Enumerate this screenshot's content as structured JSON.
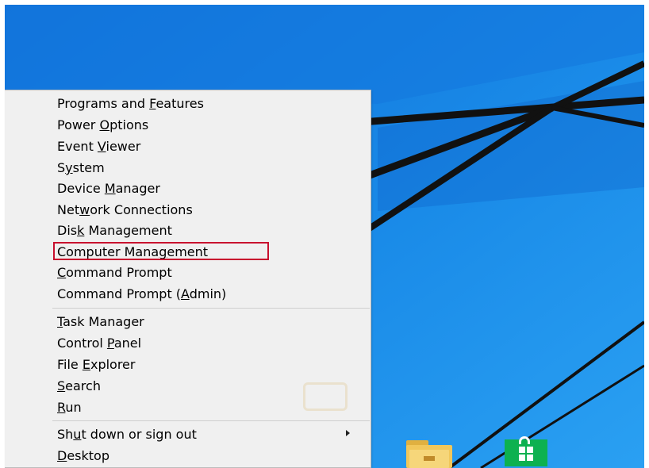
{
  "menu": {
    "group1": [
      {
        "pre": "Programs and ",
        "key": "F",
        "post": "eatures"
      },
      {
        "pre": "Power ",
        "key": "O",
        "post": "ptions"
      },
      {
        "pre": "Event ",
        "key": "V",
        "post": "iewer"
      },
      {
        "pre": "S",
        "key": "y",
        "post": "stem"
      },
      {
        "pre": "Device ",
        "key": "M",
        "post": "anager"
      },
      {
        "pre": "Net",
        "key": "w",
        "post": "ork Connections"
      },
      {
        "pre": "Dis",
        "key": "k",
        "post": " Management"
      },
      {
        "pre": "Computer Mana",
        "key": "g",
        "post": "ement"
      },
      {
        "pre": "",
        "key": "C",
        "post": "ommand Prompt"
      },
      {
        "pre": "Command Prompt (",
        "key": "A",
        "post": "dmin)"
      }
    ],
    "group2": [
      {
        "pre": "",
        "key": "T",
        "post": "ask Manager"
      },
      {
        "pre": "Control ",
        "key": "P",
        "post": "anel"
      },
      {
        "pre": "File ",
        "key": "E",
        "post": "xplorer"
      },
      {
        "pre": "",
        "key": "S",
        "post": "earch"
      },
      {
        "pre": "",
        "key": "R",
        "post": "un"
      }
    ],
    "group3": [
      {
        "pre": "Sh",
        "key": "u",
        "post": "t down or sign out"
      },
      {
        "pre": "",
        "key": "D",
        "post": "esktop"
      }
    ],
    "highlighted": "Computer Management"
  },
  "taskbar": {
    "icons": [
      "file-explorer-icon",
      "store-icon"
    ]
  },
  "colors": {
    "desktop_blue": "#1a8be8",
    "desktop_deep_blue": "#0a5fc4",
    "menu_background": "#f0f0f0",
    "highlight_border": "#c8102e",
    "store_green": "#0db150",
    "folder_yellow": "#f1c75b"
  }
}
